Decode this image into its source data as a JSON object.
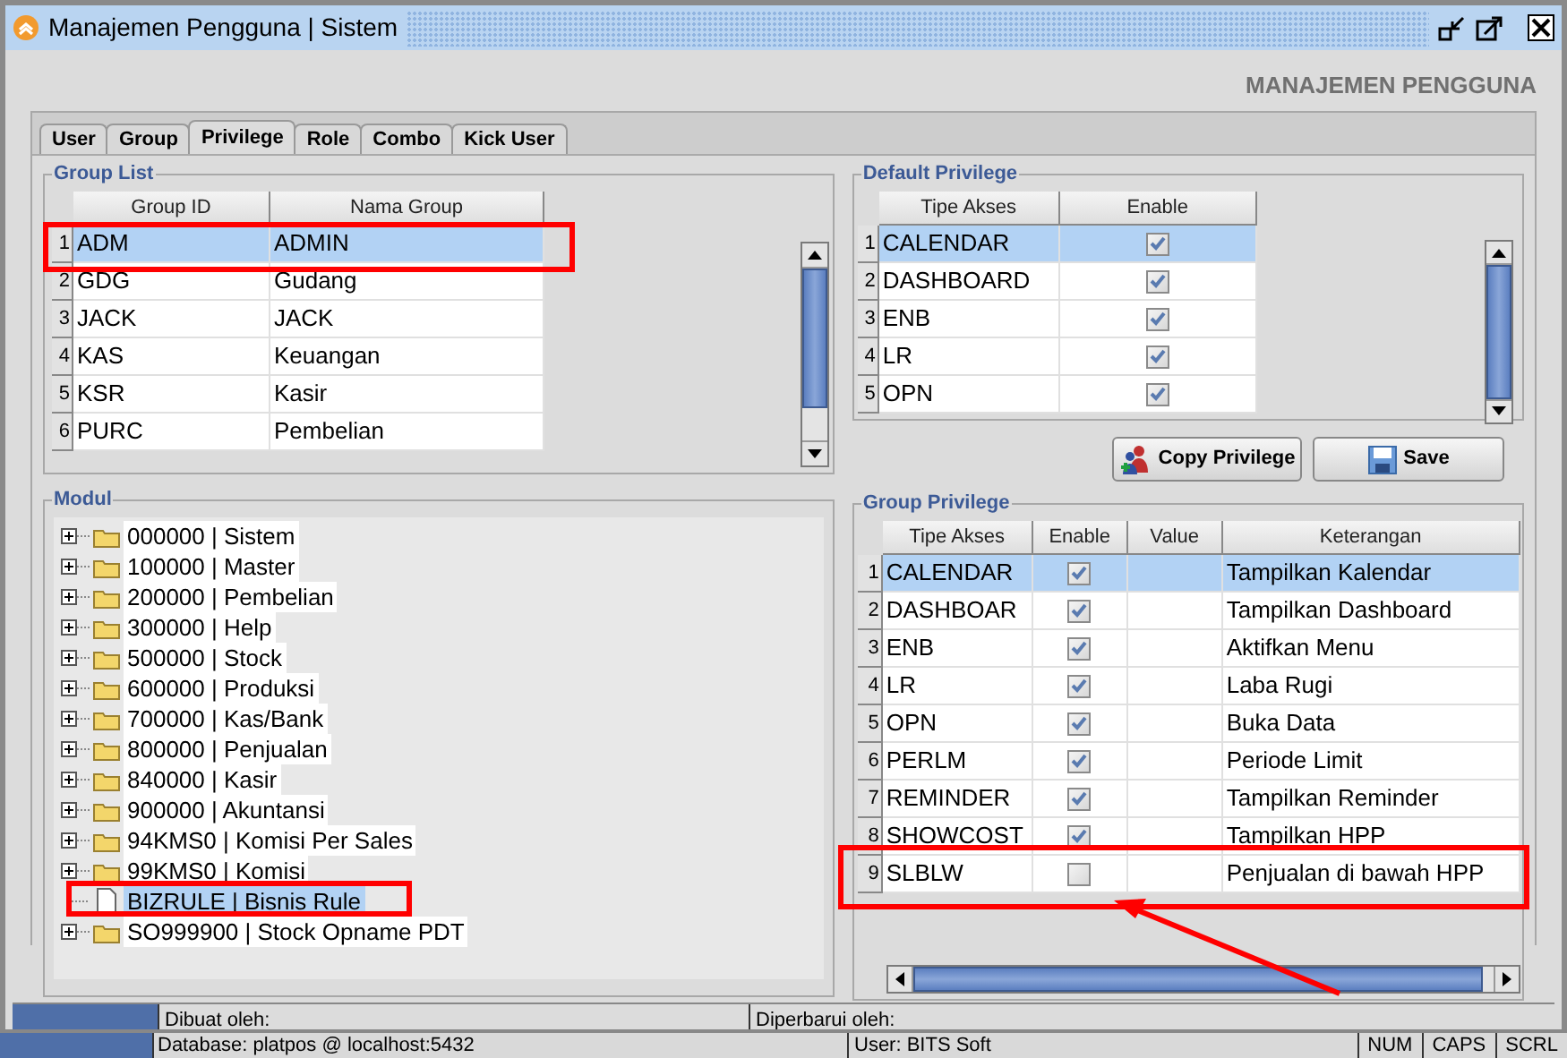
{
  "window": {
    "title": "Manajemen Pengguna | Sistem"
  },
  "header": "MANAJEMEN PENGGUNA",
  "tabs": [
    {
      "label": "User",
      "selected": false
    },
    {
      "label": "Group",
      "selected": false
    },
    {
      "label": "Privilege",
      "selected": true
    },
    {
      "label": "Role",
      "selected": false
    },
    {
      "label": "Combo",
      "selected": false
    },
    {
      "label": "Kick User",
      "selected": false
    }
  ],
  "group_list": {
    "title": "Group List",
    "columns": [
      "Group ID",
      "Nama Group"
    ],
    "rows": [
      {
        "number": "1",
        "group_id": "ADM",
        "nama_group": "ADMIN",
        "selected": true
      },
      {
        "number": "2",
        "group_id": "GDG",
        "nama_group": "Gudang",
        "selected": false
      },
      {
        "number": "3",
        "group_id": "JACK",
        "nama_group": "JACK",
        "selected": false
      },
      {
        "number": "4",
        "group_id": "KAS",
        "nama_group": "Keuangan",
        "selected": false
      },
      {
        "number": "5",
        "group_id": "KSR",
        "nama_group": "Kasir",
        "selected": false
      },
      {
        "number": "6",
        "group_id": "PURC",
        "nama_group": "Pembelian",
        "selected": false
      }
    ]
  },
  "default_privilege": {
    "title": "Default Privilege",
    "columns": [
      "Tipe Akses",
      "Enable"
    ],
    "rows": [
      {
        "number": "1",
        "tipe_akses": "CALENDAR",
        "enable": true,
        "selected": true
      },
      {
        "number": "2",
        "tipe_akses": "DASHBOARD",
        "enable": true,
        "selected": false
      },
      {
        "number": "3",
        "tipe_akses": "ENB",
        "enable": true,
        "selected": false
      },
      {
        "number": "4",
        "tipe_akses": "LR",
        "enable": true,
        "selected": false
      },
      {
        "number": "5",
        "tipe_akses": "OPN",
        "enable": true,
        "selected": false
      }
    ]
  },
  "buttons": [
    {
      "label": "Copy Privilege",
      "kind": "copy"
    },
    {
      "label": "Save",
      "kind": "save"
    }
  ],
  "modul": {
    "title": "Modul",
    "items": [
      {
        "label": "000000 | Sistem",
        "kind": "folder",
        "selected": false
      },
      {
        "label": "100000 | Master",
        "kind": "folder",
        "selected": false
      },
      {
        "label": "200000 | Pembelian",
        "kind": "folder",
        "selected": false
      },
      {
        "label": "300000 | Help",
        "kind": "folder",
        "selected": false
      },
      {
        "label": "500000 | Stock",
        "kind": "folder",
        "selected": false
      },
      {
        "label": "600000 | Produksi",
        "kind": "folder",
        "selected": false
      },
      {
        "label": "700000 | Kas/Bank",
        "kind": "folder",
        "selected": false
      },
      {
        "label": "800000 | Penjualan",
        "kind": "folder",
        "selected": false
      },
      {
        "label": "840000 | Kasir",
        "kind": "folder",
        "selected": false
      },
      {
        "label": "900000 | Akuntansi",
        "kind": "folder",
        "selected": false
      },
      {
        "label": "94KMS0 | Komisi Per Sales",
        "kind": "folder",
        "selected": false
      },
      {
        "label": "99KMS0 | Komisi",
        "kind": "folder",
        "selected": false
      },
      {
        "label": "BIZRULE | Bisnis Rule",
        "kind": "file",
        "selected": true
      },
      {
        "label": "SO999900 | Stock Opname PDT",
        "kind": "folder",
        "selected": false
      }
    ]
  },
  "group_privilege": {
    "title": "Group Privilege",
    "columns": [
      "Tipe Akses",
      "Enable",
      "Value",
      "Keterangan"
    ],
    "rows": [
      {
        "number": "1",
        "tipe_akses": "CALENDAR",
        "enable": true,
        "keterangan": "Tampilkan Kalendar",
        "selected": true
      },
      {
        "number": "2",
        "tipe_akses": "DASHBOAR",
        "enable": true,
        "keterangan": "Tampilkan Dashboard",
        "selected": false
      },
      {
        "number": "3",
        "tipe_akses": "ENB",
        "enable": true,
        "keterangan": "Aktifkan Menu",
        "selected": false
      },
      {
        "number": "4",
        "tipe_akses": "LR",
        "enable": true,
        "keterangan": "Laba Rugi",
        "selected": false
      },
      {
        "number": "5",
        "tipe_akses": "OPN",
        "enable": true,
        "keterangan": "Buka Data",
        "selected": false
      },
      {
        "number": "6",
        "tipe_akses": "PERLM",
        "enable": true,
        "keterangan": "Periode Limit",
        "selected": false
      },
      {
        "number": "7",
        "tipe_akses": "REMINDER",
        "enable": true,
        "keterangan": "Tampilkan Reminder",
        "selected": false
      },
      {
        "number": "8",
        "tipe_akses": "SHOWCOST",
        "enable": true,
        "keterangan": "Tampilkan HPP",
        "selected": false
      },
      {
        "number": "9",
        "tipe_akses": "SLBLW",
        "enable": false,
        "keterangan": "Penjualan di bawah HPP",
        "selected": false
      }
    ]
  },
  "footer": {
    "created_by": "Dibuat oleh:",
    "updated_by": "Diperbarui oleh:"
  },
  "status_bar": {
    "database": "Database: platpos @ localhost:5432",
    "user": "User: BITS Soft",
    "indicators": [
      "NUM",
      "CAPS",
      "SCRL"
    ]
  }
}
